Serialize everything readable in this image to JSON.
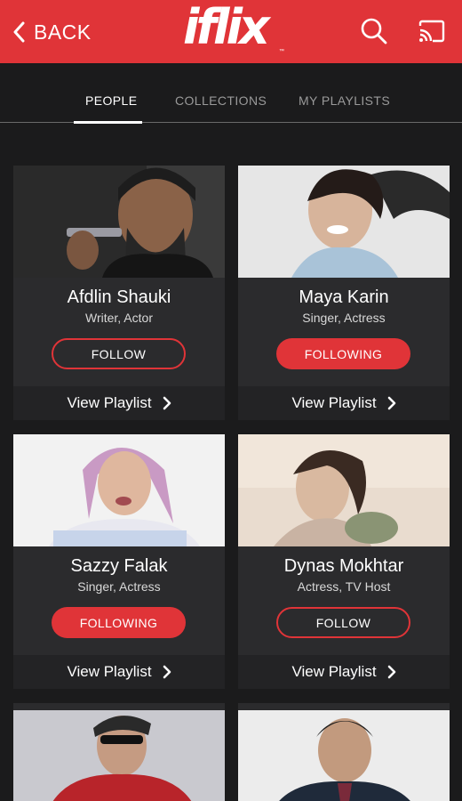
{
  "header": {
    "back_label": "BACK",
    "logo_text": "iflix",
    "logo_tm": "™",
    "brand_color": "#e03438",
    "icons": [
      "chevron-left-icon",
      "search-icon",
      "cast-icon"
    ]
  },
  "tabs": [
    {
      "label": "PEOPLE",
      "active": true
    },
    {
      "label": "COLLECTIONS",
      "active": false
    },
    {
      "label": "MY PLAYLISTS",
      "active": false
    }
  ],
  "people": [
    {
      "name": "Afdlin Shauki",
      "role": "Writer, Actor",
      "follow_label": "FOLLOW",
      "following": false,
      "playlist_label": "View Playlist"
    },
    {
      "name": "Maya Karin",
      "role": "Singer, Actress",
      "follow_label": "FOLLOWING",
      "following": true,
      "playlist_label": "View Playlist"
    },
    {
      "name": "Sazzy Falak",
      "role": "Singer, Actress",
      "follow_label": "FOLLOWING",
      "following": true,
      "playlist_label": "View Playlist"
    },
    {
      "name": "Dynas Mokhtar",
      "role": "Actress, TV Host",
      "follow_label": "FOLLOW",
      "following": false,
      "playlist_label": "View Playlist"
    }
  ]
}
